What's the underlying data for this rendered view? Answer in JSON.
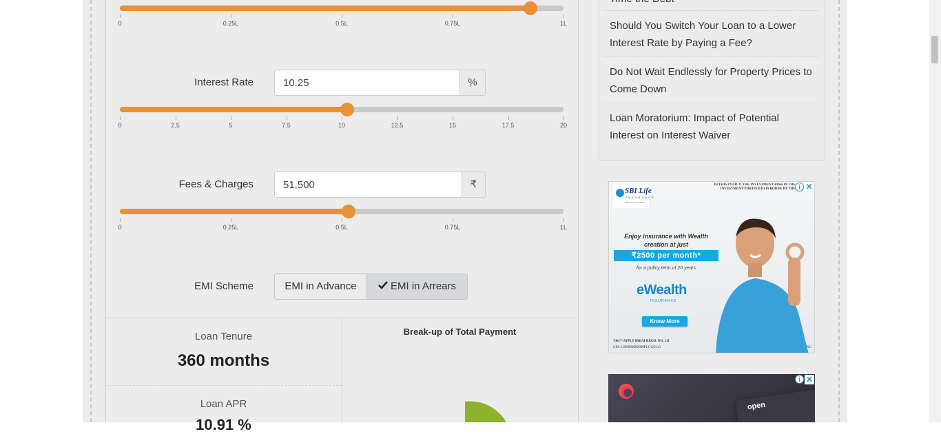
{
  "loan_slider": {
    "value_fraction": 0.925,
    "ticks": [
      "0",
      "0.25L",
      "0.5L",
      "0.75L",
      "1L"
    ]
  },
  "interest": {
    "label": "Interest Rate",
    "value": "10.25",
    "unit": "%",
    "value_fraction": 0.5125,
    "ticks": [
      "0",
      "2.5",
      "5",
      "7.5",
      "10",
      "12.5",
      "15",
      "17.5",
      "20"
    ]
  },
  "fees": {
    "label": "Fees & Charges",
    "value": "51,500",
    "unit": "₹",
    "value_fraction": 0.515,
    "ticks": [
      "0",
      "0.25L",
      "0.5L",
      "0.75L",
      "1L"
    ]
  },
  "emi_scheme": {
    "label": "EMI Scheme",
    "option_advance": "EMI in Advance",
    "option_arrears": "EMI in Arrears",
    "selected": "arrears"
  },
  "results": {
    "tenure_label": "Loan Tenure",
    "tenure_value": "360 months",
    "apr_label": "Loan APR",
    "apr_value": "10.91 %",
    "chart_title": "Break-up of Total Payment"
  },
  "sidebar": {
    "partial_item": "Time the Debt",
    "items": [
      "Should You Switch Your Loan to a Lower Interest Rate by Paying a Fee?",
      "Do Not Wait Endlessly for Property Prices to Come Down",
      "Loan Moratorium: Impact of Potential Interest on Interest Waiver"
    ]
  },
  "ad1": {
    "brand": "SBI Life",
    "brand_sub": "INSURANCE",
    "tagline": "With Us, You're Sure",
    "disclaimer": "IN THIS POLICY, THE INVESTMENT RISK IN THE INVESTMENT PORTFOLIO IS BORNE BY THE POLICYHOLDER",
    "headline": "Enjoy insurance with Wealth creation at just",
    "price": "₹2500 per month*",
    "term": "for a policy term of 20 years",
    "product": "eWealth",
    "product_sub": "INSURANCE",
    "cta": "Know More",
    "footer": "T&C* APPLY  IRDAI REGD. NO. 111",
    "cin": "CIN: L99999MH2000PLC129113",
    "code": "1Q PFCH 08-20 WEB ENG"
  },
  "ad2": {
    "brand": "open"
  },
  "colors": {
    "accent": "#e9913a",
    "track": "#c9c9c9",
    "chart_green": "#8db32c"
  }
}
